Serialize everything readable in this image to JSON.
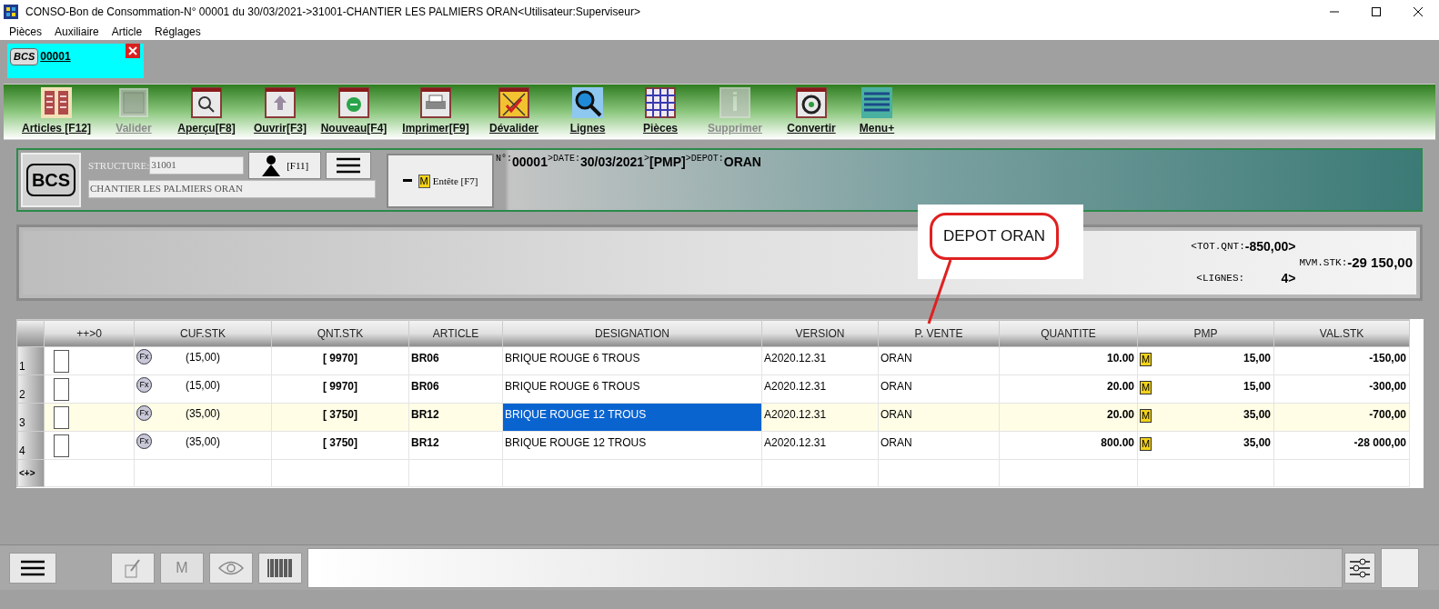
{
  "window": {
    "title": "CONSO-Bon de Consommation-N° 00001 du 30/03/2021->31001-CHANTIER LES PALMIERS ORAN<Utilisateur:Superviseur>"
  },
  "menu": [
    "Pièces",
    "Auxiliaire",
    "Article",
    "Réglages"
  ],
  "doc_tabs": [
    {
      "badge": "BCS",
      "label": "00001",
      "selected": true
    }
  ],
  "toolbar": [
    {
      "label": "Articles [F12]",
      "disabled": false
    },
    {
      "label": "Valider",
      "disabled": true
    },
    {
      "label": "Aperçu[F8]",
      "disabled": false
    },
    {
      "label": "Ouvrir[F3]",
      "disabled": false
    },
    {
      "label": "Nouveau[F4]",
      "disabled": false
    },
    {
      "label": "Imprimer[F9]",
      "disabled": false
    },
    {
      "label": "Dévalider",
      "disabled": false
    },
    {
      "label": "Lignes",
      "disabled": false
    },
    {
      "label": "Pièces",
      "disabled": false
    },
    {
      "label": "Supprimer",
      "disabled": true
    },
    {
      "label": "Convertir",
      "disabled": false
    },
    {
      "label": "Menu+",
      "disabled": false
    }
  ],
  "header": {
    "badge": "BCS",
    "structure_label": "STRUCTURE:",
    "structure_code": "31001",
    "structure_name": "CHANTIER LES PALMIERS ORAN",
    "user_key": "[F11]",
    "entete_marker": "M",
    "entete_label": "Entête [F7]",
    "info": [
      {
        "label": "N°:",
        "value": "00001"
      },
      {
        "label": ">DATE:",
        "value": "30/03/2021"
      },
      {
        "label": ">",
        "value": "[PMP]"
      },
      {
        "label": ">DEPOT:",
        "value": "ORAN"
      }
    ]
  },
  "summary": {
    "tot_qnt_label": "<TOT.QNT:",
    "tot_qnt": "-850,00>",
    "lignes_label": "<LIGNES:",
    "lignes": "4>",
    "mvm_label": "MVM.STK:",
    "mvm": "-29 150,00"
  },
  "callout": {
    "text": "DEPOT ORAN"
  },
  "grid": {
    "columns": [
      "++>0",
      "CUF.STK",
      "QNT.STK",
      "ARTICLE",
      "DESIGNATION",
      "VERSION",
      "P. VENTE",
      "QUANTITE",
      "PMP",
      "VAL.STK"
    ],
    "rows": [
      {
        "number": "1",
        "checked": false,
        "selected": false,
        "fx": "Fx",
        "cuf": "(15,00)",
        "qnt_stk": "[ 9970]",
        "article": "BR06",
        "designation": "BRIQUE ROUGE 6 TROUS",
        "designation_selected": false,
        "version": "A2020.12.31",
        "p_vente": "ORAN",
        "quantite": "10.00",
        "pmp_flag": "M",
        "pmp": "15,00",
        "val_stk": "-150,00"
      },
      {
        "number": "2",
        "checked": false,
        "selected": false,
        "fx": "Fx",
        "cuf": "(15,00)",
        "qnt_stk": "[ 9970]",
        "article": "BR06",
        "designation": "BRIQUE ROUGE 6 TROUS",
        "designation_selected": false,
        "version": "A2020.12.31",
        "p_vente": "ORAN",
        "quantite": "20.00",
        "pmp_flag": "M",
        "pmp": "15,00",
        "val_stk": "-300,00"
      },
      {
        "number": "3",
        "checked": false,
        "selected": true,
        "fx": "Fx",
        "cuf": "(35,00)",
        "qnt_stk": "[ 3750]",
        "article": "BR12",
        "designation": "BRIQUE ROUGE 12 TROUS",
        "designation_selected": true,
        "version": "A2020.12.31",
        "p_vente": "ORAN",
        "quantite": "20.00",
        "pmp_flag": "M",
        "pmp": "35,00",
        "val_stk": "-700,00"
      },
      {
        "number": "4",
        "checked": false,
        "selected": false,
        "fx": "Fx",
        "cuf": "(35,00)",
        "qnt_stk": "[ 3750]",
        "article": "BR12",
        "designation": "BRIQUE ROUGE 12 TROUS",
        "designation_selected": false,
        "version": "A2020.12.31",
        "p_vente": "ORAN",
        "quantite": "800.00",
        "pmp_flag": "M",
        "pmp": "35,00",
        "val_stk": "-28 000,00"
      }
    ],
    "new_row_marker": "<+>"
  },
  "bottom_bar": {
    "m_button": "M"
  }
}
